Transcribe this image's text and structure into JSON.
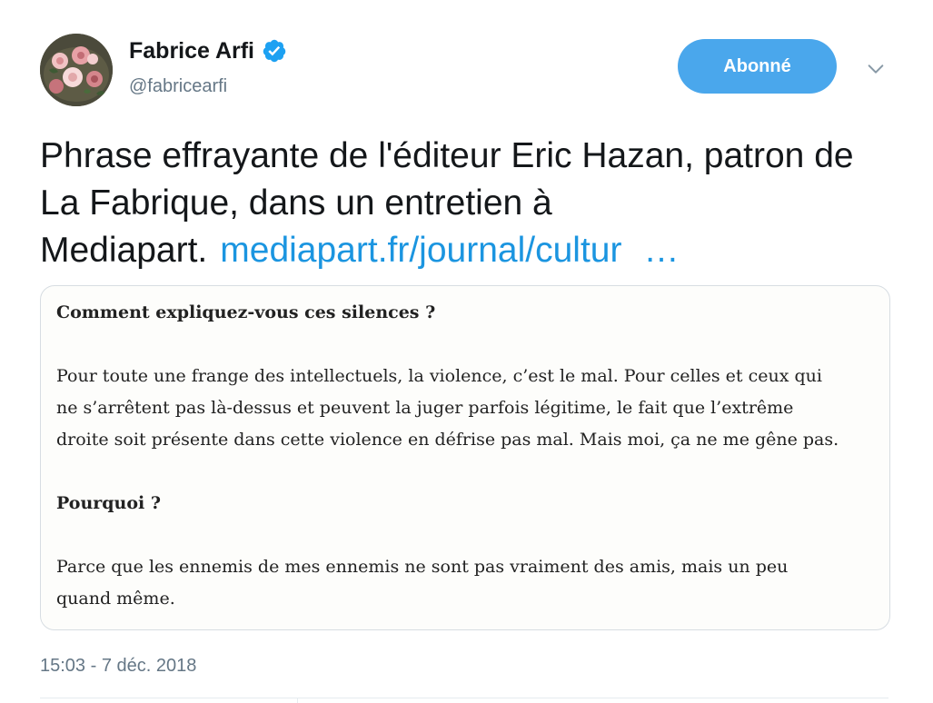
{
  "author": {
    "display_name": "Fabrice Arfi",
    "handle": "@fabricearfi",
    "verified_icon": "verified-badge-icon",
    "avatar_icon": "roses-avatar"
  },
  "actions": {
    "follow_label": "Abonné",
    "menu_icon": "chevron-down-icon"
  },
  "tweet": {
    "text": "Phrase effrayante de l'éditeur Eric Hazan, patron de La Fabrique, dans un entretien à Mediapart.",
    "link_text": "mediapart.fr/journal/cultur",
    "ellipsis": "…"
  },
  "media": {
    "question1": "Comment expliquez-vous ces silences ?",
    "answer1_line1": "Pour toute une frange des intellectuels, la violence, c’est le mal. Pour celles et ceux qui",
    "answer1_line2": "ne s’arrêtent pas là-dessus et peuvent la juger parfois légitime, le fait que l’extrême",
    "answer1_line3": "droite soit présente dans cette violence en défrise pas mal. Mais moi, ça ne me gêne pas.",
    "question2": "Pourquoi ?",
    "answer2_line1": "Parce que les ennemis de mes ennemis ne sont pas vraiment des amis, mais un peu",
    "answer2_line2": "quand même."
  },
  "meta": {
    "timestamp": "15:03 - 7 déc. 2018"
  },
  "colors": {
    "accent": "#1b95e0",
    "follow_button": "#4aa7ec",
    "verified": "#1da1f2",
    "secondary_text": "#657786"
  }
}
